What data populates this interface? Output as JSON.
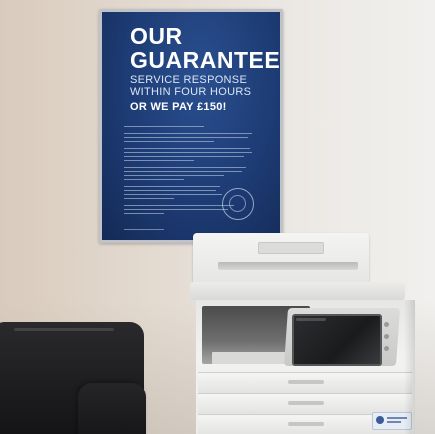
{
  "poster": {
    "title": "OUR\nGUARANTEE",
    "subtitle": "SERVICE RESPONSE\nWITHIN FOUR HOURS",
    "offer": "OR WE PAY £150!"
  },
  "colors": {
    "poster_blue": "#1d3b74",
    "wall": "#e3dad0",
    "copier_body": "#ececea",
    "chair": "#1c1c1f",
    "screen": "#1a1b1d"
  }
}
